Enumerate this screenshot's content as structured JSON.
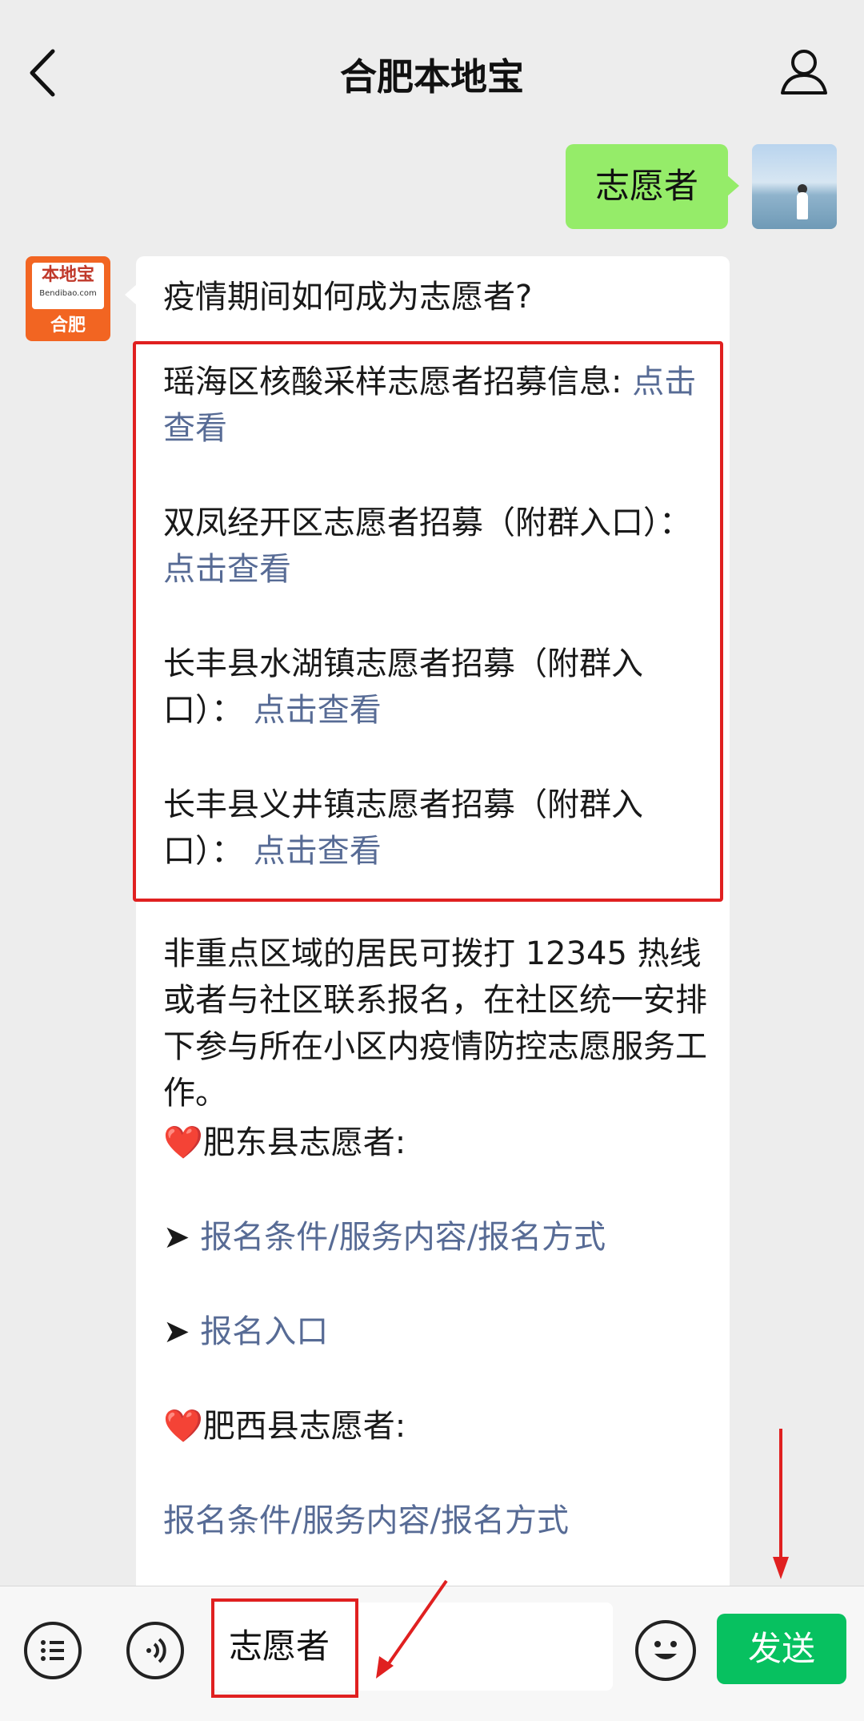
{
  "header": {
    "title": "合肥本地宝"
  },
  "chat": {
    "sent": {
      "text": "志愿者"
    },
    "bot_avatar": {
      "top_text": "本地宝",
      "sub_text": "Bendibao.com",
      "bottom_text": "合肥"
    },
    "received": {
      "question": "疫情期间如何成为志愿者?",
      "highlighted": [
        {
          "text": "瑶海区核酸采样志愿者招募信息:",
          "link": "点击查看"
        },
        {
          "text": "双凤经开区志愿者招募（附群入口）：",
          "link": "点击查看"
        },
        {
          "text": "长丰县水湖镇志愿者招募（附群入口）：",
          "link": "点击查看"
        },
        {
          "text": "长丰县义井镇志愿者招募（附群入口）：",
          "link": "点击查看"
        }
      ],
      "paragraph": "非重点区域的居民可拨打 12345 热线或者与社区联系报名，在社区统一安排下参与所在小区内疫情防控志愿服务工作。",
      "section1_title": "❤️肥东县志愿者:",
      "section1_links": [
        {
          "bullet": "➤",
          "text": "报名条件/服务内容/报名方式"
        },
        {
          "bullet": "➤",
          "text": "报名入口"
        }
      ],
      "section2_title": "❤️肥西县志愿者:",
      "section2_link": "报名条件/服务内容/报名方式"
    }
  },
  "inputbar": {
    "input_value": "志愿者",
    "send_label": "发送"
  },
  "colors": {
    "accent_green": "#07c160",
    "bubble_green": "#95ec69",
    "link_blue": "#576b95",
    "annotation_red": "#e02020"
  }
}
